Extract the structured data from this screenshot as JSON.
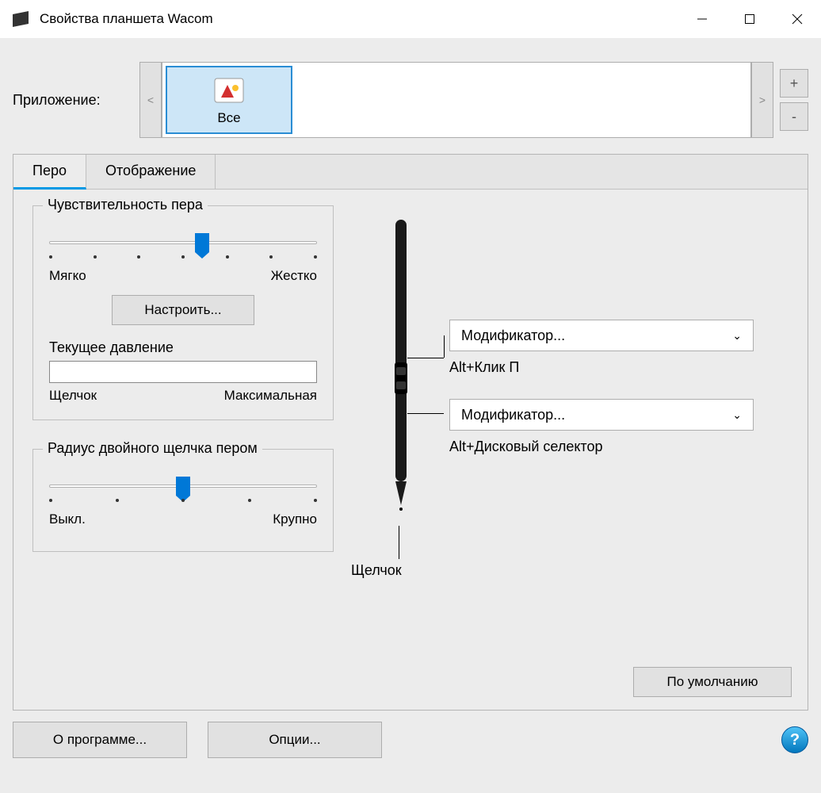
{
  "window": {
    "title": "Свойства планшета Wacom"
  },
  "appRow": {
    "label": "Приложение:",
    "tile": {
      "label": "Все"
    },
    "plus": "+",
    "minus": "-",
    "prev": "<",
    "next": ">"
  },
  "tabs": {
    "pen": "Перо",
    "mapping": "Отображение"
  },
  "tipFeel": {
    "title": "Чувствительность пера",
    "soft": "Мягко",
    "firm": "Жестко",
    "customize": "Настроить...",
    "value_pct": 57
  },
  "pressure": {
    "title": "Текущее давление",
    "click": "Щелчок",
    "max": "Максимальная"
  },
  "dblClick": {
    "title": "Радиус двойного щелчка пером",
    "off": "Выкл.",
    "large": "Крупно",
    "value_pct": 50
  },
  "pen": {
    "tip": "Щелчок",
    "btn1": {
      "select": "Модификатор...",
      "value": "Alt+Клик П"
    },
    "btn2": {
      "select": "Модификатор...",
      "value": "Alt+Дисковый селектор"
    }
  },
  "buttons": {
    "default": "По умолчанию",
    "about": "О программе...",
    "options": "Опции..."
  }
}
